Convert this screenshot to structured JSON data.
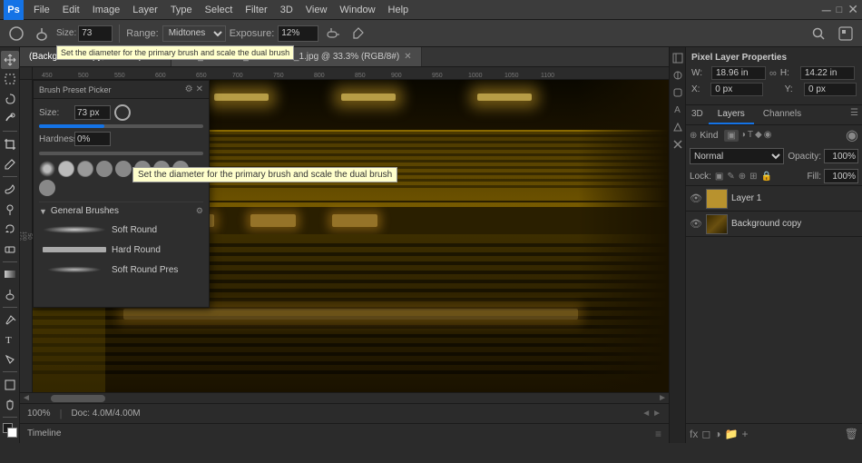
{
  "app": {
    "title": "Adobe Photoshop",
    "ps_label": "Ps"
  },
  "menu": {
    "items": [
      "File",
      "Edit",
      "Image",
      "Layer",
      "Type",
      "Select",
      "Filter",
      "3D",
      "View",
      "Window",
      "Help"
    ]
  },
  "options_bar": {
    "range_label": "Range:",
    "range_value": "Midtones",
    "exposure_label": "Exposure:",
    "exposure_value": "12%",
    "size_label": "Size:",
    "size_value": "73 px"
  },
  "tabs": [
    {
      "label": "(Background copy, RGB/8#) ×",
      "active": true
    },
    {
      "label": "IMG_20150722_140833764_1.jpg @ 33.3% (RGB/8#) ×",
      "active": false
    }
  ],
  "ruler": {
    "marks": [
      "450",
      "500",
      "550",
      "600",
      "650",
      "700",
      "750",
      "800",
      "850",
      "900",
      "950",
      "1000",
      "1050",
      "1100"
    ]
  },
  "brush_panel": {
    "size_label": "Size:",
    "size_value": "73 px",
    "hardness_label": "Hardness:",
    "hardness_value": "0%",
    "tooltip": "Set the diameter for the primary brush and scale the dual brush",
    "section_label": "General Brushes",
    "brushes": [
      {
        "name": "Soft Round",
        "type": "soft"
      },
      {
        "name": "Hard Round",
        "type": "hard"
      },
      {
        "name": "Soft Round Pres",
        "type": "soft"
      }
    ]
  },
  "properties": {
    "title": "Pixel Layer Properties",
    "w_label": "W:",
    "w_value": "18.96 in",
    "h_label": "H:",
    "h_value": "14.22 in",
    "x_label": "X:",
    "x_value": "0 px",
    "y_label": "Y:",
    "y_value": "0 px"
  },
  "layers": {
    "tab_3d": "3D",
    "tab_layers": "Layers",
    "tab_channels": "Channels",
    "filter_label": "Kind",
    "mode_label": "Normal",
    "opacity_label": "Opacity:",
    "opacity_value": "100%",
    "lock_label": "Lock:",
    "fill_label": "Fill:",
    "fill_value": "100%",
    "items": [
      {
        "name": "Layer 1",
        "type": "solid",
        "color": "#b8922e",
        "active": false
      },
      {
        "name": "Background copy",
        "type": "image",
        "color": "#5a4010",
        "active": false
      }
    ]
  },
  "status": {
    "zoom": "100%",
    "doc_info": "Doc: 4.0M/4.00M"
  },
  "timeline": {
    "label": "Timeline"
  }
}
